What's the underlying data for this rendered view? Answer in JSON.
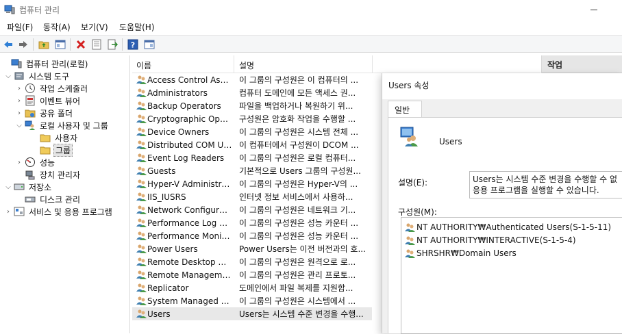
{
  "window": {
    "title": "컴퓨터 관리"
  },
  "menu": [
    "파일(F)",
    "동작(A)",
    "보기(V)",
    "도움말(H)"
  ],
  "toolbar": {
    "buttons": [
      "back-arrow-icon",
      "forward-arrow-icon",
      "up-folder-icon",
      "show-hide-tree-icon",
      "delete-icon",
      "properties-icon",
      "export-icon",
      "help-icon",
      "action-pane-icon"
    ]
  },
  "tree": [
    {
      "label": "컴퓨터 관리(로컬)",
      "icon": "computer-management-icon",
      "level": 0,
      "chevron": ""
    },
    {
      "label": "시스템 도구",
      "icon": "system-tools-icon",
      "level": 1,
      "chevron": "expanded"
    },
    {
      "label": "작업 스케줄러",
      "icon": "task-scheduler-icon",
      "level": 2,
      "chevron": "collapsed"
    },
    {
      "label": "이벤트 뷰어",
      "icon": "event-viewer-icon",
      "level": 2,
      "chevron": "collapsed"
    },
    {
      "label": "공유 폴더",
      "icon": "shared-folder-icon",
      "level": 2,
      "chevron": "collapsed"
    },
    {
      "label": "로컬 사용자 및 그룹",
      "icon": "local-users-groups-icon",
      "level": 2,
      "chevron": "expanded"
    },
    {
      "label": "사용자",
      "icon": "folder-icon",
      "level": 3,
      "chevron": ""
    },
    {
      "label": "그룹",
      "icon": "folder-icon",
      "level": 3,
      "chevron": "",
      "selected": true
    },
    {
      "label": "성능",
      "icon": "performance-icon",
      "level": 2,
      "chevron": "collapsed"
    },
    {
      "label": "장치 관리자",
      "icon": "device-manager-icon",
      "level": 2,
      "chevron": ""
    },
    {
      "label": "저장소",
      "icon": "storage-icon",
      "level": 1,
      "chevron": "expanded"
    },
    {
      "label": "디스크 관리",
      "icon": "disk-management-icon",
      "level": 2,
      "chevron": ""
    },
    {
      "label": "서비스 및 응용 프로그램",
      "icon": "services-apps-icon",
      "level": 1,
      "chevron": "collapsed"
    }
  ],
  "list": {
    "columns": [
      "이름",
      "설명"
    ],
    "rows": [
      {
        "name": "Access Control Assist...",
        "desc": "이 그룹의 구성원은 이 컴퓨터의 ..."
      },
      {
        "name": "Administrators",
        "desc": "컴퓨터 도메인에 모든 액세스 권..."
      },
      {
        "name": "Backup Operators",
        "desc": "파일을 백업하거나 복원하기 위..."
      },
      {
        "name": "Cryptographic Operat...",
        "desc": "구성원은 암호화 작업을 수행할 ..."
      },
      {
        "name": "Device Owners",
        "desc": "이 그룹의 구성원은 시스템 전체 ..."
      },
      {
        "name": "Distributed COM Users",
        "desc": "이 컴퓨터에서 구성원이 DCOM ..."
      },
      {
        "name": "Event Log Readers",
        "desc": "이 그룹의 구성원은 로컬 컴퓨터..."
      },
      {
        "name": "Guests",
        "desc": "기본적으로 Users 그룹의 구성원..."
      },
      {
        "name": "Hyper-V Administrat...",
        "desc": "이 그룹의 구성원은 Hyper-V의 ..."
      },
      {
        "name": "IIS_IUSRS",
        "desc": "인터넷 정보 서비스에서 사용하..."
      },
      {
        "name": "Network Configuratio...",
        "desc": "이 그룹의 구성원은 네트워크 기..."
      },
      {
        "name": "Performance Log Users",
        "desc": "이 그룹의 구성원은 성능 카운터 ..."
      },
      {
        "name": "Performance Monitor...",
        "desc": "이 그룹의 구성원은 성능 카운터 ..."
      },
      {
        "name": "Power Users",
        "desc": "Power Users는 이전 버전과의 호..."
      },
      {
        "name": "Remote Desktop Users",
        "desc": "이 그룹의 구성원은 원격으로 로..."
      },
      {
        "name": "Remote Management...",
        "desc": "이 그룹의 구성원은 관리 프로토..."
      },
      {
        "name": "Replicator",
        "desc": "도메인에서 파일 복제를 지원합..."
      },
      {
        "name": "System Managed Acc...",
        "desc": "이 그룹의 구성원은 시스템에서 ..."
      },
      {
        "name": "Users",
        "desc": "Users는 시스템 수준 변경을 수행...",
        "selected": true
      }
    ]
  },
  "actions": {
    "title": "작업"
  },
  "dialog": {
    "title": "Users 속성",
    "tab": "일반",
    "group_name": "Users",
    "description_label": "설명(E):",
    "description": "Users는 시스템 수준 변경을 수행할 수 없\n응용 프로그램을 실행할 수 있습니다.",
    "members_label": "구성원(M):",
    "members": [
      "NT AUTHORITY₩Authenticated Users(S-1-5-11)",
      "NT AUTHORITY₩INTERACTIVE(S-1-5-4)",
      "SHRSHR₩Domain Users"
    ]
  },
  "colors": {
    "selection": "#e5e5e5",
    "toolbar_bg": "#f5f6f7",
    "dialog_bg": "#f0f0f0",
    "header_bg": "#e6e6e6"
  }
}
